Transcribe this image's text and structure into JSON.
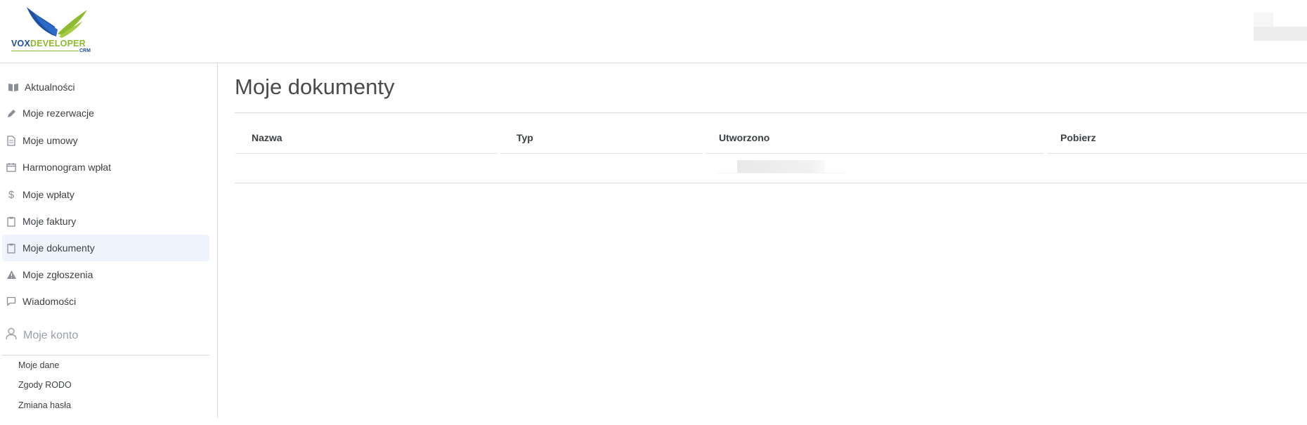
{
  "logo": {
    "brand_part1": "VOX",
    "brand_part2": "DEVELOPER",
    "suffix": "CRM"
  },
  "sidebar": {
    "items": [
      {
        "label": "Aktualności",
        "icon": "open-book-icon"
      },
      {
        "label": "Moje rezerwacje",
        "icon": "pencil-icon"
      },
      {
        "label": "Moje umowy",
        "icon": "document-icon"
      },
      {
        "label": "Harmonogram wpłat",
        "icon": "calendar-icon"
      },
      {
        "label": "Moje wpłaty",
        "icon": "dollar-icon"
      },
      {
        "label": "Moje faktury",
        "icon": "clipboard-icon"
      },
      {
        "label": "Moje dokumenty",
        "icon": "clipboard-icon",
        "active": true
      },
      {
        "label": "Moje zgłoszenia",
        "icon": "warning-icon"
      },
      {
        "label": "Wiadomości",
        "icon": "chat-icon"
      }
    ],
    "account": {
      "label": "Moje konto",
      "icon": "user-icon",
      "items": [
        "Moje dane",
        "Zgody RODO",
        "Zmiana hasła"
      ]
    }
  },
  "main": {
    "title": "Moje dokumenty",
    "table": {
      "columns": [
        "Nazwa",
        "Typ",
        "Utworzono",
        "Pobierz"
      ]
    }
  },
  "colors": {
    "brand_blue": "#1f4fa3",
    "brand_green": "#8dba2e",
    "active_bg": "#eef3fd",
    "border": "#dcdcdc"
  }
}
